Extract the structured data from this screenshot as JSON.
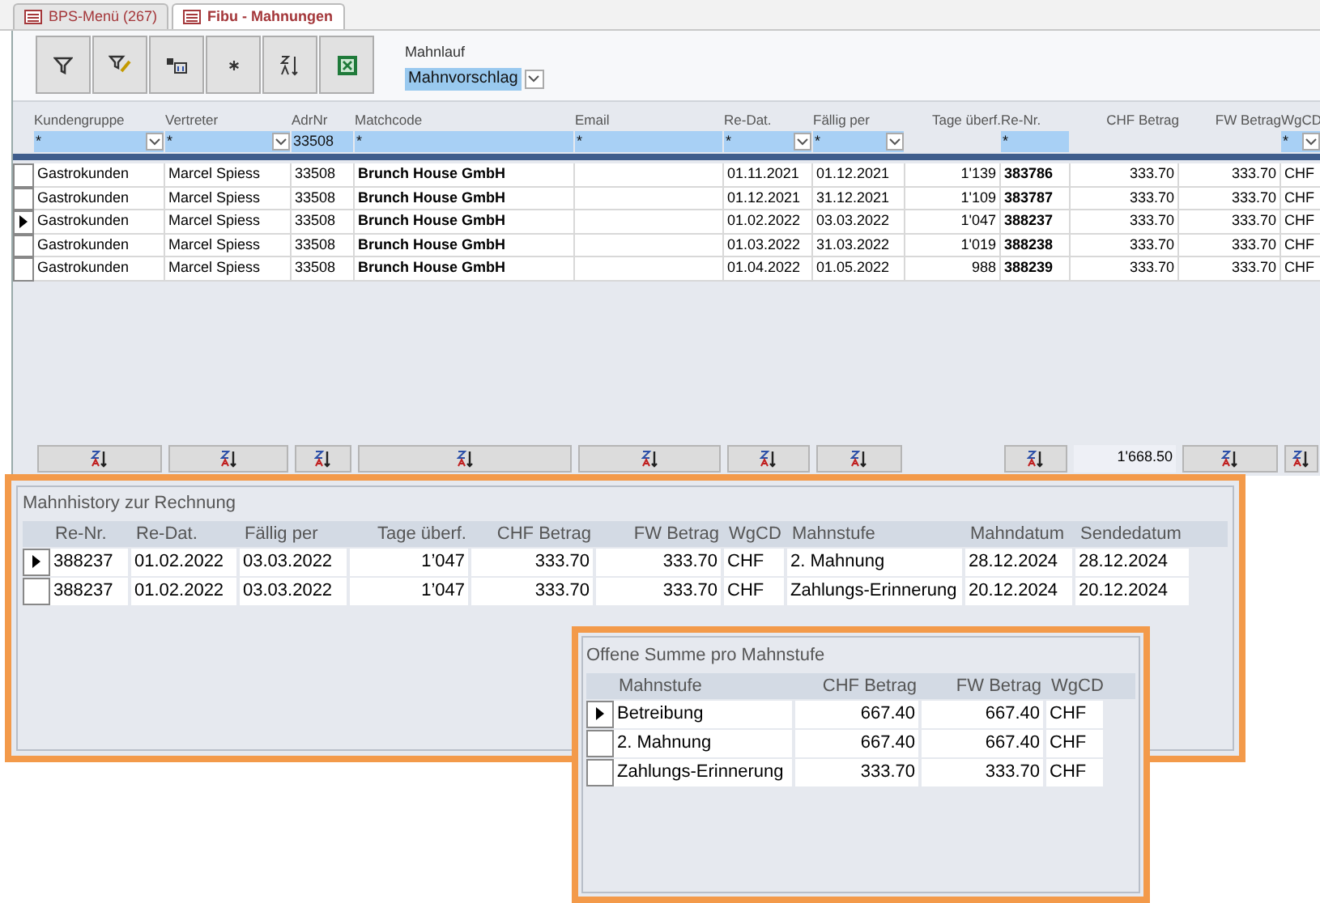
{
  "tabs": [
    {
      "label": "BPS-Menü (267)",
      "selected": false
    },
    {
      "label": "Fibu - Mahnungen",
      "selected": true
    }
  ],
  "mahnlauf": {
    "label": "Mahnlauf",
    "value": "Mahnvorschlag"
  },
  "grid": {
    "columns": [
      {
        "label": "Kundengruppe",
        "filter": "*",
        "dropdown": true,
        "sortable": true
      },
      {
        "label": "Vertreter",
        "filter": "*",
        "dropdown": true,
        "sortable": true
      },
      {
        "label": "AdrNr",
        "filter": "33508",
        "dropdown": false,
        "sortable": true
      },
      {
        "label": "Matchcode",
        "filter": "*",
        "dropdown": false,
        "sortable": true
      },
      {
        "label": "Email",
        "filter": "*",
        "dropdown": false,
        "sortable": true
      },
      {
        "label": "Re-Dat.",
        "filter": "*",
        "dropdown": true,
        "sortable": true
      },
      {
        "label": "Fällig per",
        "filter": "*",
        "dropdown": true,
        "sortable": true
      },
      {
        "label": "Tage überf.",
        "sortable": false
      },
      {
        "label": "Re-Nr.",
        "filter": "*",
        "dropdown": false,
        "sortable": true
      },
      {
        "label": "CHF Betrag",
        "sortable": false
      },
      {
        "label": "FW Betrag",
        "sortable": true
      },
      {
        "label": "WgCD",
        "filter": "*",
        "dropdown": true,
        "sortable": true
      }
    ],
    "rows": [
      {
        "current": false,
        "cells": [
          "Gastrokunden",
          "Marcel Spiess",
          "33508",
          "Brunch House GmbH",
          "",
          "01.11.2021",
          "01.12.2021",
          "1'139",
          "383786",
          "333.70",
          "333.70",
          "CHF"
        ]
      },
      {
        "current": false,
        "cells": [
          "Gastrokunden",
          "Marcel Spiess",
          "33508",
          "Brunch House GmbH",
          "",
          "01.12.2021",
          "31.12.2021",
          "1'109",
          "383787",
          "333.70",
          "333.70",
          "CHF"
        ]
      },
      {
        "current": true,
        "cells": [
          "Gastrokunden",
          "Marcel Spiess",
          "33508",
          "Brunch House GmbH",
          "",
          "01.02.2022",
          "03.03.2022",
          "1'047",
          "388237",
          "333.70",
          "333.70",
          "CHF"
        ]
      },
      {
        "current": false,
        "cells": [
          "Gastrokunden",
          "Marcel Spiess",
          "33508",
          "Brunch House GmbH",
          "",
          "01.03.2022",
          "31.03.2022",
          "1'019",
          "388238",
          "333.70",
          "333.70",
          "CHF"
        ]
      },
      {
        "current": false,
        "cells": [
          "Gastrokunden",
          "Marcel Spiess",
          "33508",
          "Brunch House GmbH",
          "",
          "01.04.2022",
          "01.05.2022",
          "988",
          "388239",
          "333.70",
          "333.70",
          "CHF"
        ]
      }
    ],
    "total": "1'668.50"
  },
  "history": {
    "title": "Mahnhistory zur Rechnung",
    "columns": [
      "Re-Nr.",
      "Re-Dat.",
      "Fällig per",
      "Tage überf.",
      "CHF Betrag",
      "FW Betrag",
      "WgCD",
      "Mahnstufe",
      "Mahndatum",
      "Sendedatum"
    ],
    "rows": [
      {
        "current": true,
        "cells": [
          "388237",
          "01.02.2022",
          "03.03.2022",
          "1’047",
          "333.70",
          "333.70",
          "CHF",
          "2. Mahnung",
          "28.12.2024",
          "28.12.2024"
        ]
      },
      {
        "current": false,
        "cells": [
          "388237",
          "01.02.2022",
          "03.03.2022",
          "1’047",
          "333.70",
          "333.70",
          "CHF",
          "Zahlungs-Erinnerung",
          "20.12.2024",
          "20.12.2024"
        ]
      }
    ]
  },
  "summary": {
    "title": "Offene Summe pro Mahnstufe",
    "columns": [
      "Mahnstufe",
      "CHF Betrag",
      "FW Betrag",
      "WgCD"
    ],
    "rows": [
      {
        "current": true,
        "cells": [
          "Betreibung",
          "667.40",
          "667.40",
          "CHF"
        ]
      },
      {
        "current": false,
        "cells": [
          "2. Mahnung",
          "667.40",
          "667.40",
          "CHF"
        ]
      },
      {
        "current": false,
        "cells": [
          "Zahlungs-Erinnerung",
          "333.70",
          "333.70",
          "CHF"
        ]
      }
    ]
  }
}
